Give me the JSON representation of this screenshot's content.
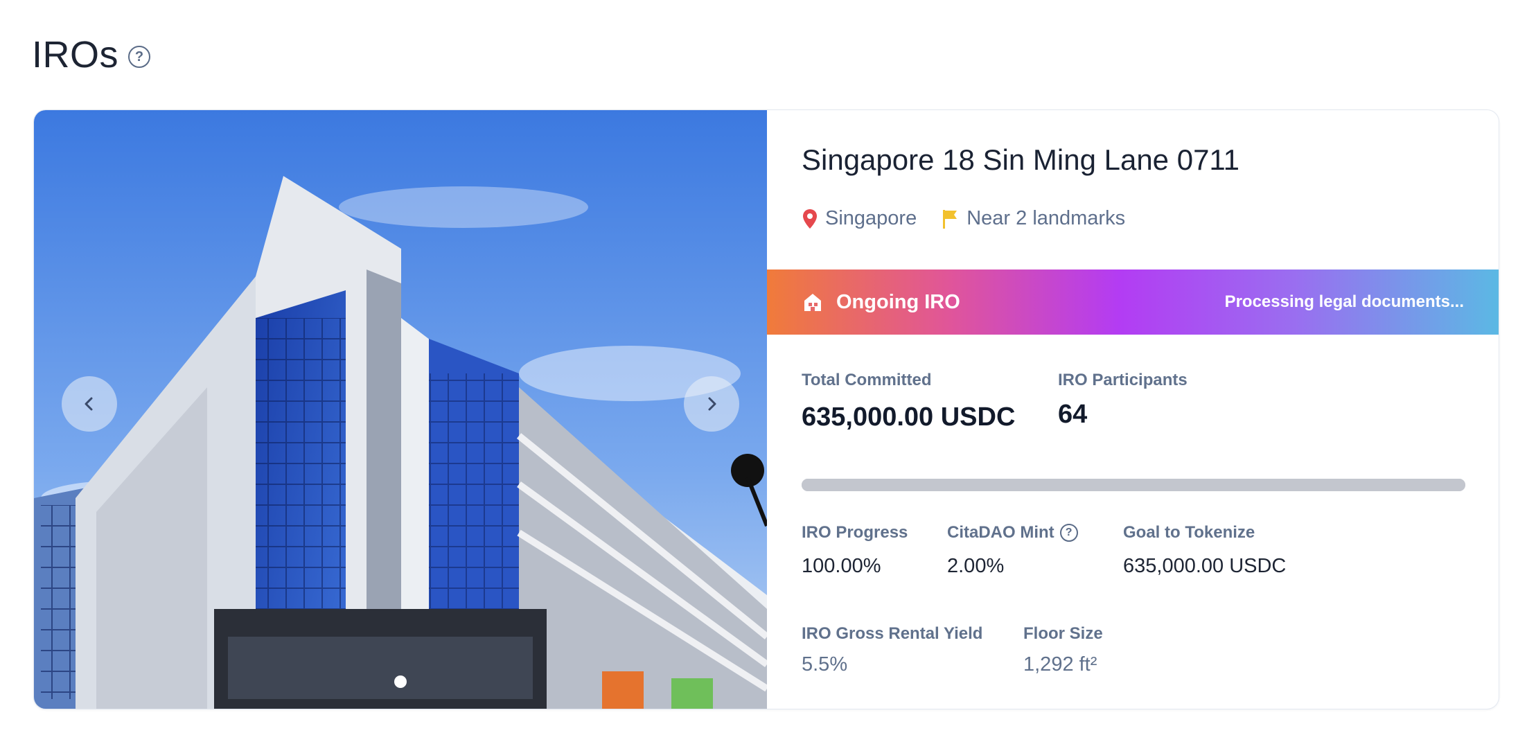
{
  "page": {
    "title": "IROs"
  },
  "carousel": {
    "slide_count": 1,
    "active_slide": 1
  },
  "property": {
    "title": "Singapore 18 Sin Ming Lane 0711",
    "location": "Singapore",
    "landmarks": "Near 2 landmarks"
  },
  "banner": {
    "status": "Ongoing IRO",
    "message": "Processing legal documents..."
  },
  "stats": {
    "total_committed_label": "Total Committed",
    "total_committed_value": "635,000.00 USDC",
    "participants_label": "IRO Participants",
    "participants_value": "64",
    "progress_label": "IRO Progress",
    "progress_value": "100.00%",
    "progress_fraction": 1.0,
    "mint_label": "CitaDAO Mint",
    "mint_value": "2.00%",
    "goal_label": "Goal to Tokenize",
    "goal_value": "635,000.00 USDC",
    "yield_label": "IRO Gross Rental Yield",
    "yield_value": "5.5%",
    "floor_label": "Floor Size",
    "floor_value": "1,292 ft²"
  },
  "colors": {
    "location_pin": "#e5484d",
    "landmark_flag": "#f2c12e",
    "banner_start": "#f07b3a",
    "banner_mid": "#b33cf3",
    "banner_end": "#5bb9e4",
    "progress_bar": "#c3c6ce"
  },
  "icons": {
    "help": "question-circle-icon",
    "location": "map-pin-icon",
    "landmark": "flag-icon",
    "status": "building-icon",
    "prev": "chevron-left-icon",
    "next": "chevron-right-icon"
  }
}
